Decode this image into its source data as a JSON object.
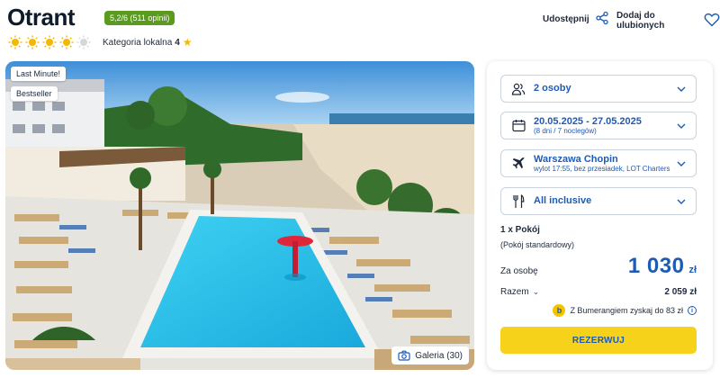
{
  "hotel": {
    "name": "Otrant",
    "rating_badge": "5,2/6 (511 opinii)",
    "suns_filled": 4,
    "suns_total": 5,
    "category_label": "Kategoria lokalna",
    "category_value": "4"
  },
  "actions": {
    "share_label": "Udostępnij",
    "favorite_label": "Dodaj do ulubionych"
  },
  "gallery": {
    "tag_last_minute": "Last Minute!",
    "tag_bestseller": "Bestseller",
    "gallery_label": "Galeria (30)"
  },
  "booking": {
    "guests": "2 osoby",
    "dates": "20.05.2025 - 27.05.2025",
    "dates_sub": "(8 dni / 7 noclegów)",
    "departure": "Warszawa Chopin",
    "departure_sub": "wylot 17:55, bez przesiadek, LOT Charters",
    "board": "All inclusive",
    "room_count": "1 x Pokój",
    "room_type": "(Pokój standardowy)",
    "per_person_label": "Za osobę",
    "price": "1 030",
    "currency": "zł",
    "total_label": "Razem",
    "total_value": "2 059 zł",
    "boomerang_text": "Z Bumerangiem zyskaj do 83 zł",
    "book_button": "REZERWUJ"
  },
  "colors": {
    "accent": "#1e5bb5",
    "badge": "#5a9a1e",
    "button": "#f7d21a",
    "sun": "#f3b800"
  }
}
